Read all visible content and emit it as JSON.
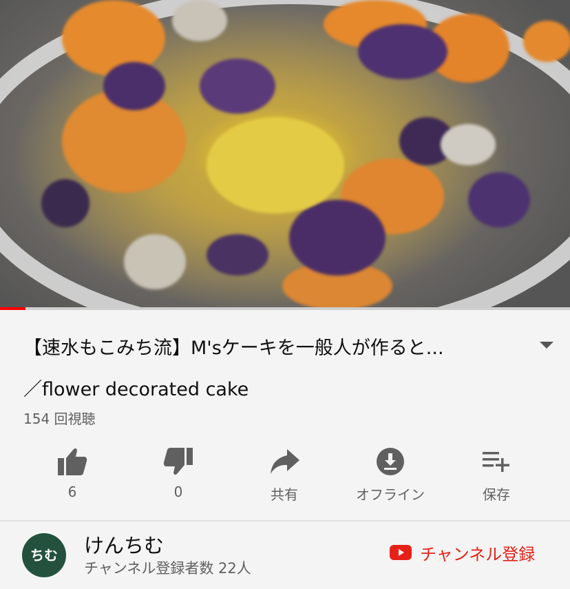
{
  "video": {
    "progress_fraction": 0.045,
    "colors": {
      "progress": "#ff0000",
      "track": "#cfcfcf"
    }
  },
  "title": {
    "line1": "【速水もこみち流】M'sケーキを一般人が作ると...",
    "line2": "／flower decorated cake",
    "expand_icon": "chevron-down-icon"
  },
  "views": "154 回視聴",
  "actions": [
    {
      "icon": "thumbs-up-icon",
      "label": "6"
    },
    {
      "icon": "thumbs-down-icon",
      "label": "0"
    },
    {
      "icon": "share-icon",
      "label": "共有"
    },
    {
      "icon": "download-icon",
      "label": "オフライン"
    },
    {
      "icon": "save-to-playlist-icon",
      "label": "保存"
    }
  ],
  "channel": {
    "avatar_text": "ちむ",
    "avatar_color": "#24513d",
    "name": "けんちむ",
    "subscribers": "チャンネル登録者数 22人",
    "subscribe_label": "チャンネル登録",
    "subscribe_color": "#e62117"
  }
}
